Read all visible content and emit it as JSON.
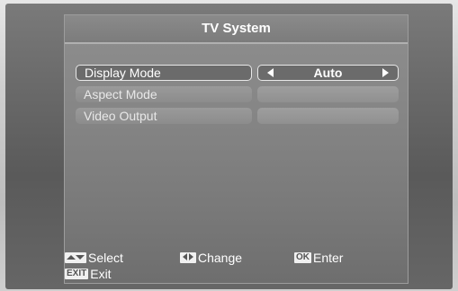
{
  "window": {
    "title": "TV System"
  },
  "menu": {
    "items": [
      {
        "label": "Display Mode",
        "value": "Auto",
        "selected": true
      },
      {
        "label": "Aspect Mode",
        "value": "",
        "selected": false
      },
      {
        "label": "Video Output",
        "value": "",
        "selected": false
      }
    ]
  },
  "footer": {
    "select_label": "Select",
    "change_label": "Change",
    "ok_key": "OK",
    "enter_label": "Enter",
    "exit_key": "EXIT",
    "exit_label": "Exit"
  },
  "icons": {
    "select": "up-down-arrows-icon",
    "change": "left-right-arrows-icon",
    "value_prev": "left-arrow-icon",
    "value_next": "right-arrow-icon"
  }
}
